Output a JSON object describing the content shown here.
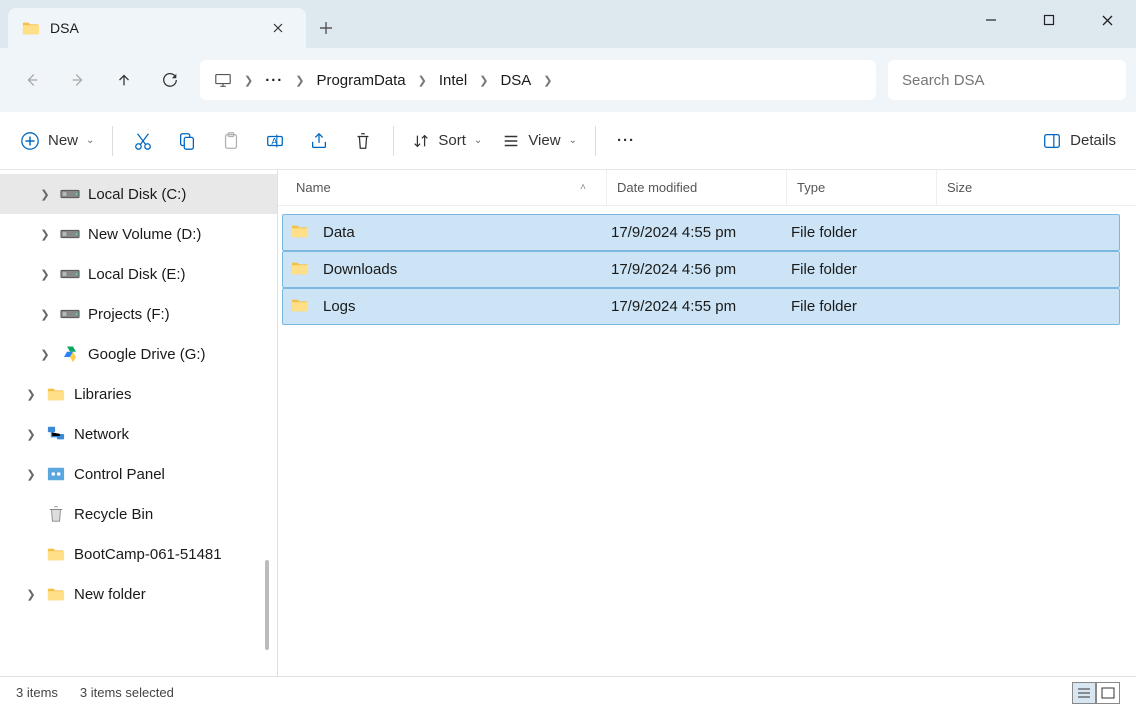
{
  "tab": {
    "title": "DSA"
  },
  "breadcrumb": {
    "segments": [
      "ProgramData",
      "Intel",
      "DSA"
    ]
  },
  "search": {
    "placeholder": "Search DSA"
  },
  "toolbar": {
    "new": "New",
    "sort": "Sort",
    "view": "View",
    "details": "Details"
  },
  "columns": {
    "name": "Name",
    "date": "Date modified",
    "type": "Type",
    "size": "Size"
  },
  "files": [
    {
      "name": "Data",
      "date": "17/9/2024 4:55 pm",
      "type": "File folder",
      "size": ""
    },
    {
      "name": "Downloads",
      "date": "17/9/2024 4:56 pm",
      "type": "File folder",
      "size": ""
    },
    {
      "name": "Logs",
      "date": "17/9/2024 4:55 pm",
      "type": "File folder",
      "size": ""
    }
  ],
  "sidebar": {
    "items": [
      {
        "label": "Local Disk (C:)",
        "icon": "disk",
        "expandable": true,
        "indent": true,
        "active": true
      },
      {
        "label": "New Volume (D:)",
        "icon": "disk",
        "expandable": true,
        "indent": true
      },
      {
        "label": "Local Disk (E:)",
        "icon": "disk",
        "expandable": true,
        "indent": true
      },
      {
        "label": "Projects (F:)",
        "icon": "disk",
        "expandable": true,
        "indent": true
      },
      {
        "label": "Google Drive (G:)",
        "icon": "gdrive",
        "expandable": true,
        "indent": true
      },
      {
        "label": "Libraries",
        "icon": "folder",
        "expandable": true,
        "indent": false
      },
      {
        "label": "Network",
        "icon": "network",
        "expandable": true,
        "indent": false
      },
      {
        "label": "Control Panel",
        "icon": "control",
        "expandable": true,
        "indent": false
      },
      {
        "label": "Recycle Bin",
        "icon": "recycle",
        "expandable": false,
        "indent": false
      },
      {
        "label": "BootCamp-061-51481",
        "icon": "folder",
        "expandable": false,
        "indent": false
      },
      {
        "label": "New folder",
        "icon": "folder",
        "expandable": true,
        "indent": false
      }
    ]
  },
  "status": {
    "count": "3 items",
    "selected": "3 items selected"
  }
}
